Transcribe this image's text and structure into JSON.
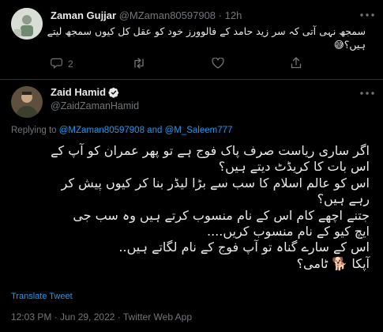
{
  "reply_tweet": {
    "display_name": "Zaman Gujjar",
    "handle": "@MZaman80597908",
    "time_sep": "·",
    "time": "12h",
    "text_line1": "سمجھ نہی آتی کہ سر زید حامد کے فالوورز خود کو عقل کل کیوں سمجھ لیتے",
    "text_line2": "ہیں؟😅",
    "reply_count": "2"
  },
  "main_tweet": {
    "display_name": "Zaid Hamid",
    "handle": "@ZaidZamanHamid",
    "verified": true,
    "replying_prefix": "Replying to",
    "replying_user1": "@MZaman80597908",
    "replying_and": "and",
    "replying_user2": "@M_Saleem777",
    "body_lines": [
      "اگر ساری ریاست صرف پاک فوج ہے تو پھر عمران کو آپ کے",
      "اس بات کا کریڈٹ دیتے ہیں؟",
      "اس کو عالم اسلام کا سب سے بڑا لیڈر بنا کر کیوں پیش کر",
      "رہے ہیں؟",
      "جتنے اچھے کام اس کے نام منسوب کرتے ہیں وہ سب جی",
      "ایچ کیو کے نام منسوب کریں....",
      "اس کے سارے گناہ تو آپ فوج کے نام لگاتے ہیں..",
      "آپکا 🐕 ٹامی؟"
    ],
    "translate_label": "Translate Tweet",
    "timestamp": "12:03 PM · Jun 29, 2022 · Twitter Web App"
  },
  "colors": {
    "background": "#000000",
    "text": "#e7e9ea",
    "muted": "#71767b",
    "accent": "#1d9bf0",
    "separator": "#2f3336"
  },
  "icons": [
    "avatar-image",
    "more-options-icon",
    "reply-icon",
    "retweet-icon",
    "like-icon",
    "share-icon",
    "verified-badge-icon"
  ]
}
